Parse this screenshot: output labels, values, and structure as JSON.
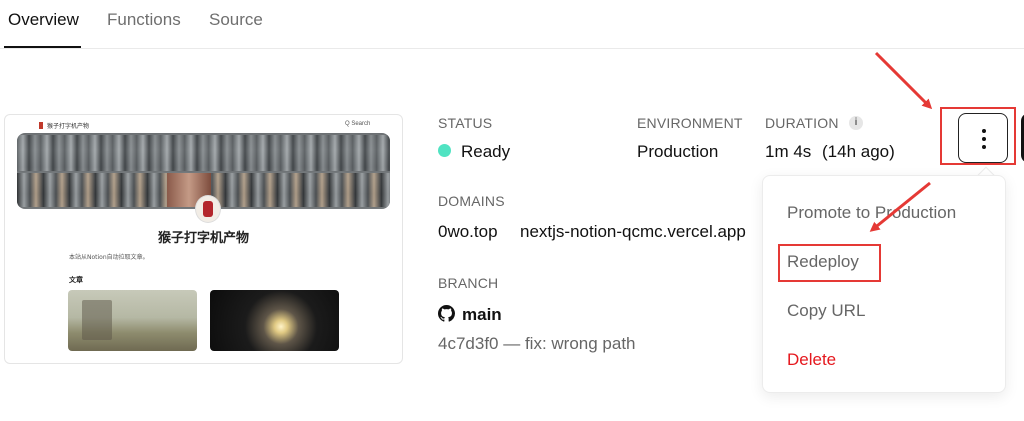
{
  "tabs": [
    {
      "label": "Overview",
      "active": true
    },
    {
      "label": "Functions",
      "active": false
    },
    {
      "label": "Source",
      "active": false
    }
  ],
  "preview": {
    "site_name": "猴子打字机产物",
    "search_label": "Q Search",
    "title": "猴子打字机产物",
    "subtitle": "本站从Notion自动拉取文章。",
    "section_label": "文章"
  },
  "status": {
    "label": "STATUS",
    "value": "Ready",
    "color": "#50e3c2"
  },
  "environment": {
    "label": "ENVIRONMENT",
    "value": "Production"
  },
  "duration": {
    "label": "DURATION",
    "info_icon": "i",
    "value": "1m 4s",
    "ago": "(14h ago)"
  },
  "domains": {
    "label": "DOMAINS",
    "items": [
      "0wo.top",
      "nextjs-notion-qcmc.vercel.app"
    ]
  },
  "branch": {
    "label": "BRANCH",
    "name": "main",
    "commit": "4c7d3f0 — fix: wrong path"
  },
  "menu": {
    "items": [
      {
        "label": "Promote to Production",
        "danger": false
      },
      {
        "label": "Redeploy",
        "danger": false
      },
      {
        "label": "Copy URL",
        "danger": false
      },
      {
        "label": "Delete",
        "danger": true
      }
    ]
  },
  "colors": {
    "annotation": "#e53935",
    "danger": "#e5181e"
  }
}
